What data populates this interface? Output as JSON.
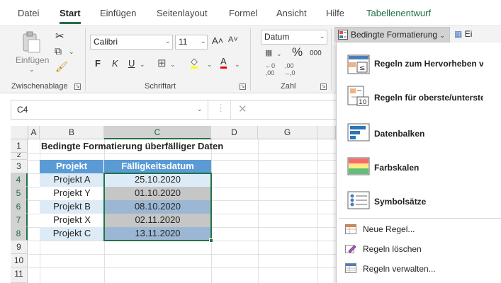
{
  "tabs": [
    "Datei",
    "Start",
    "Einfügen",
    "Seitenlayout",
    "Formel",
    "Ansicht",
    "Hilfe",
    "Tabellenentwurf"
  ],
  "ribbon": {
    "clipboard": {
      "paste_label": "Einfügen",
      "group_label": "Zwischenablage"
    },
    "font": {
      "family": "Calibri",
      "size": "11",
      "bold": "F",
      "italic": "K",
      "underline": "U",
      "grow": "A˄",
      "shrink": "A˅",
      "group_label": "Schriftart"
    },
    "number": {
      "format": "Datum",
      "percent": "%",
      "thousands": "000",
      "group_label": "Zahl"
    },
    "cond_format_label": "Bedingte Formatierung",
    "next_cut": "Ei"
  },
  "formula_bar": {
    "name_box": "C4",
    "cancel": "✕",
    "value": ""
  },
  "columns": [
    "A",
    "B",
    "C",
    "D",
    "G"
  ],
  "rows": [
    "1",
    "2",
    "3",
    "4",
    "5",
    "6",
    "7",
    "8",
    "9",
    "10",
    "11"
  ],
  "sheet": {
    "title": "Bedingte Formatierung überfälliger Daten",
    "header_project": "Projekt",
    "header_due": "Fälligkeitsdatum",
    "data": [
      {
        "project": "Projekt A",
        "date": "25.10.2020"
      },
      {
        "project": "Projekt Y",
        "date": "01.10.2020"
      },
      {
        "project": "Projekt B",
        "date": "08.10.2020"
      },
      {
        "project": "Projekt X",
        "date": "02.11.2020"
      },
      {
        "project": "Projekt C",
        "date": "13.11.2020"
      }
    ]
  },
  "menu": {
    "highlight_rules": "Regeln zum Hervorheben v",
    "top_bottom_rules": "Regeln für oberste/unterste",
    "data_bars": "Datenbalken",
    "color_scales": "Farbskalen",
    "icon_sets": "Symbolsätze",
    "new_rule": "Neue Regel...",
    "clear_rules": "Regeln löschen",
    "manage_rules": "Regeln verwalten..."
  },
  "colors": {
    "excel_green": "#217346",
    "header_blue": "#5b9bd5",
    "row_light": "#ddebf7",
    "date_gray": "#c6c6c6",
    "date_blue": "#9bb7d4"
  }
}
